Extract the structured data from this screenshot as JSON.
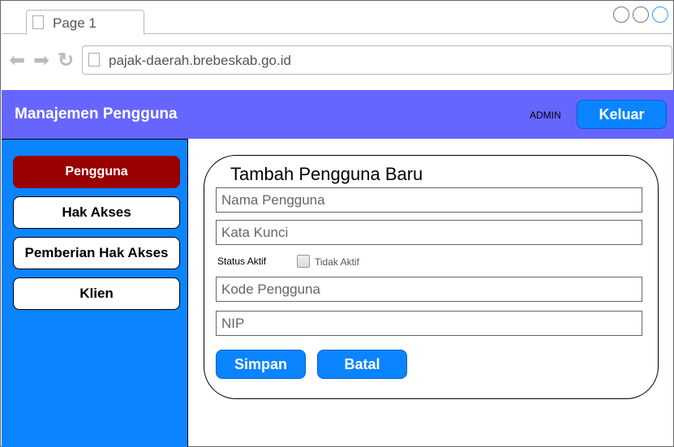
{
  "browser": {
    "tab_label": "Page 1",
    "url": "pajak-daerah.brebeskab.go.id"
  },
  "header": {
    "title": "Manajemen Pengguna",
    "user": "ADMIN",
    "logout": "Keluar"
  },
  "sidebar": {
    "items": [
      {
        "label": "Pengguna"
      },
      {
        "label": "Hak Akses"
      },
      {
        "label": "Pemberian Hak Akses"
      },
      {
        "label": "Klien"
      }
    ]
  },
  "form": {
    "title": "Tambah Pengguna Baru",
    "name_placeholder": "Nama Pengguna",
    "password_placeholder": "Kata Kunci",
    "status_label": "Status Aktif",
    "status_checkbox_label": "Tidak Aktif",
    "code_placeholder": "Kode Pengguna",
    "nip_placeholder": "NIP",
    "save": "Simpan",
    "cancel": "Batal"
  },
  "colors": {
    "header": "#6666ff",
    "sidebar": "#0a84ff",
    "active": "#990000"
  }
}
